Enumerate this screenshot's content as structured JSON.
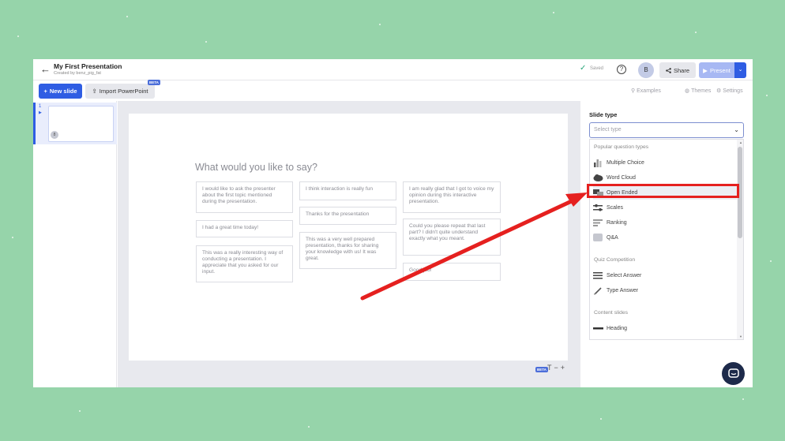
{
  "window": {
    "title": "My First Presentation",
    "creator": "Created by benz_pig_fat",
    "saved": "Saved",
    "help": "?",
    "avatar": "B",
    "share": "Share",
    "present": "Present"
  },
  "toolbar": {
    "new_slide": "New slide",
    "import_ppt": "Import PowerPoint",
    "beta": "BETA",
    "examples": "Examples",
    "themes": "Themes",
    "settings": "Settings"
  },
  "slides_panel": {
    "slide_number": "1",
    "badge": "8"
  },
  "slide": {
    "question": "What would you like to say?",
    "responses": [
      "I would like to ask the presenter about the first topic mentioned during the presentation.",
      "I had a great time today!",
      "This was a really interesting way of conducting a presentation. I appreciate that you asked for our input.",
      "I think interaction is really fun",
      "Thanks for the presentation",
      "This was a very well prepared presentation, thanks for sharing your knowledge with us! It was great.",
      "I am really glad that I got to voice my opinion during this interactive presentation.",
      "Could you please repeat that last part? I didn't quite understand exactly what you meant.",
      "Good job!"
    ],
    "beta": "BETA",
    "font_controls": [
      "T",
      "−",
      "+"
    ]
  },
  "slide_type": {
    "label": "Slide type",
    "placeholder": "Select type",
    "groups": [
      {
        "title": "Popular question types",
        "items": [
          "Multiple Choice",
          "Word Cloud",
          "Open Ended",
          "Scales",
          "Ranking",
          "Q&A"
        ]
      },
      {
        "title": "Quiz Competition",
        "items": [
          "Select Answer",
          "Type Answer"
        ]
      },
      {
        "title": "Content slides",
        "items": [
          "Heading"
        ]
      }
    ],
    "highlighted_item": "Open Ended"
  },
  "icons": {
    "back": "arrow-left-icon",
    "saved": "check-icon",
    "share": "share-icon",
    "present": "play-icon",
    "chat": "chat-bubble-icon"
  },
  "colors": {
    "background": "#96d4aa",
    "accent": "#2f5de3",
    "annotation": "#e5201f"
  }
}
